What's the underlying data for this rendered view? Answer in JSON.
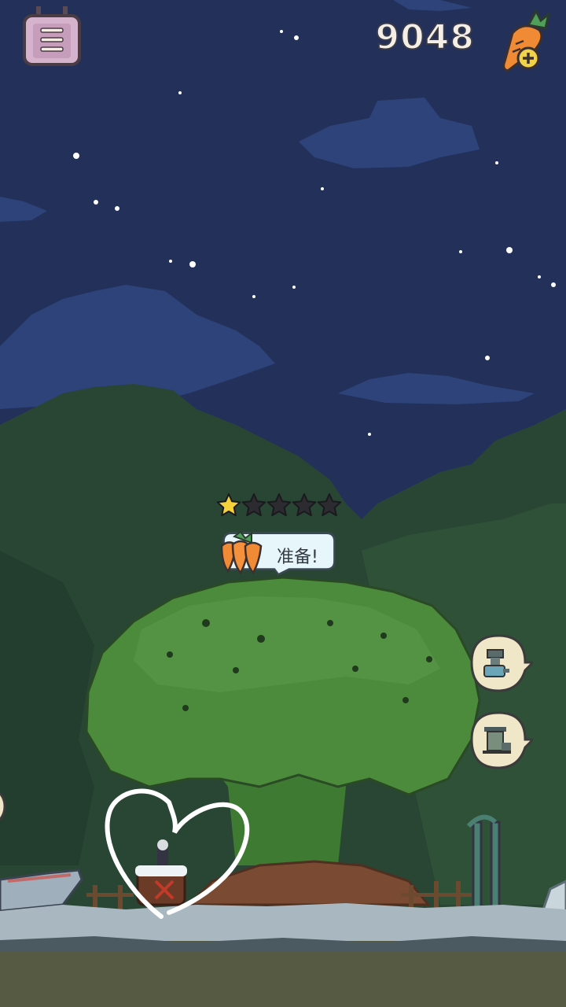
{
  "hud": {
    "menu_icon": "notebook-menu-icon",
    "carrot_count": "9048",
    "carrot_shop_icon": "carrot-plus-icon"
  },
  "level": {
    "stars_filled": 1,
    "stars_total": 5
  },
  "speech_bubble": {
    "icon": "carrot-bunch-icon",
    "text": "准备!"
  },
  "side_buttons": [
    {
      "icon": "mortar-grinder-icon"
    },
    {
      "icon": "mailbox-stand-icon"
    }
  ],
  "colors": {
    "sky": "#22305a",
    "cloud": "#2d4378",
    "hill": "#2a4a37",
    "tree": "#4f8f3d",
    "ground": "#5a5a42",
    "bubble": "#e6f6fa",
    "star_on": "#f6d23a",
    "star_off": "#2b2b30"
  }
}
